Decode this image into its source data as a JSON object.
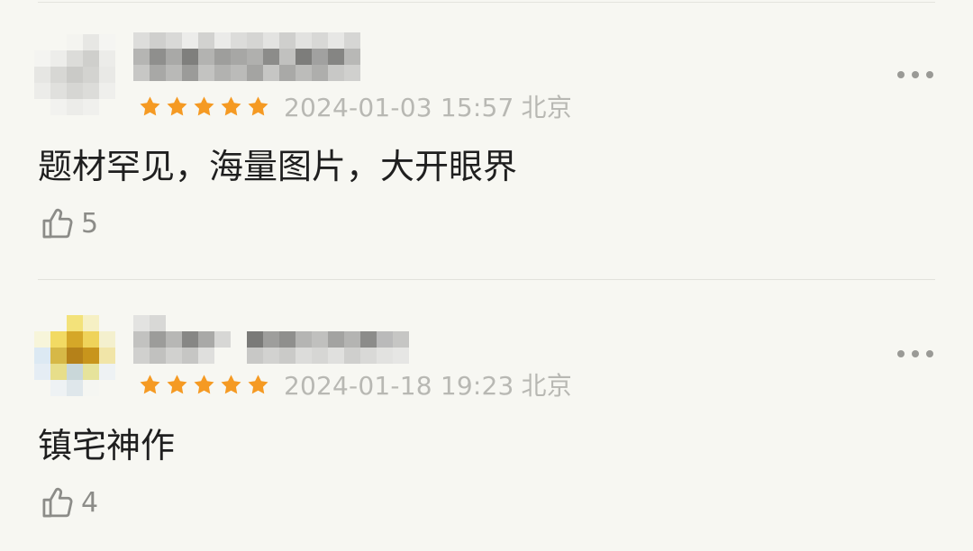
{
  "reviews": [
    {
      "rating": 5,
      "date": "2024-01-03 15:57",
      "location": "北京",
      "text": "题材罕见，海量图片，大开眼界",
      "likes": "5",
      "avatar_colors": [
        "#f2f2f0",
        "#d9d9d7",
        "#c9c9c7",
        "#e6e6e4",
        "#ffffff"
      ]
    },
    {
      "rating": 5,
      "date": "2024-01-18 19:23",
      "location": "北京",
      "text": "镇宅神作",
      "likes": "4",
      "avatar_colors": [
        "#f3e27a",
        "#e6c43f",
        "#c48d19",
        "#d9e6f2",
        "#f6f0c4"
      ]
    }
  ],
  "icons": {
    "star": "star-icon",
    "more": "more-horizontal-icon",
    "like": "thumb-up-icon"
  },
  "colors": {
    "background": "#f7f7f2",
    "star": "#f59a23",
    "meta_text": "#b8b8b3",
    "body_text": "#1f1f1f",
    "like_text": "#8c8c88"
  }
}
